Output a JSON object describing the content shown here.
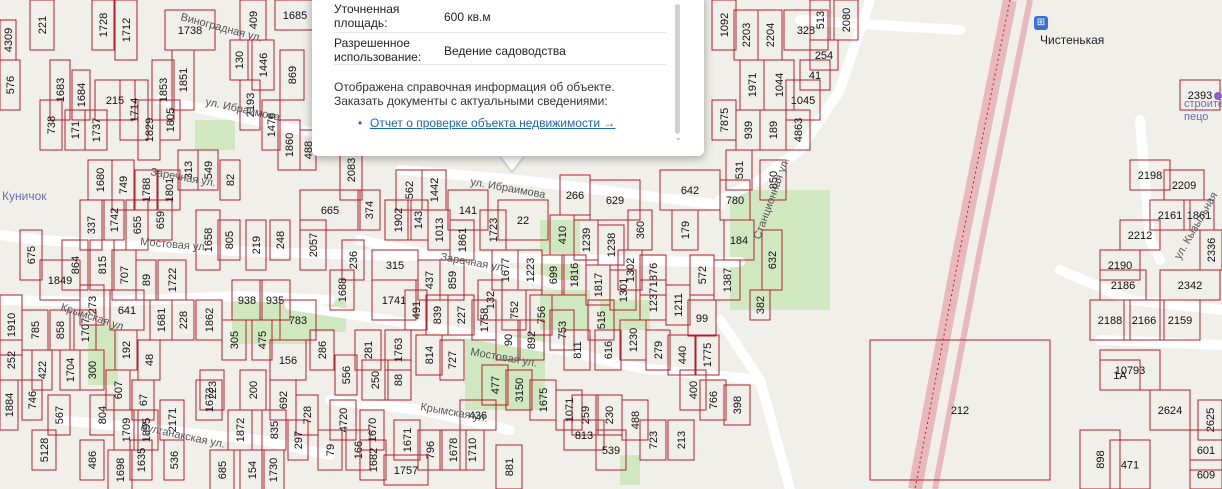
{
  "popup": {
    "rows": [
      {
        "label": "Уточненная площадь:",
        "value": "600 кв.м"
      },
      {
        "label": "Разрешенное использование:",
        "value": "Ведение садоводства"
      }
    ],
    "info_line1": "Отображена справочная информация об объекте.",
    "info_line2": "Заказать документы с актуальными сведениями:",
    "report_link": "Отчет о проверке объекта недвижимости →"
  },
  "station": {
    "icon": "metro-station-icon",
    "label": "Чистенькая"
  },
  "poi": {
    "left": "Куничок",
    "right_top": "строител",
    "right_bottom": "пецо"
  },
  "colors": {
    "parcel_border": "#b3202a",
    "road": "#ffffff",
    "green": "#cfe8c0",
    "background": "#f1efea",
    "link": "#1a66b7"
  },
  "streets": [
    "ул. Ибраимова",
    "Заречная ул.",
    "Мостовая ул.",
    "Крымская ул.",
    "Булганакская ул.",
    "ул. Ибраимова",
    "Заречная ул.",
    "Мостовая ул.",
    "Крымская ул.",
    "Станционная ул.",
    "ул. Кызыльная",
    "Виноградная ул."
  ],
  "parcels": [
    {
      "n": "221"
    },
    {
      "n": "1728"
    },
    {
      "n": "1712"
    },
    {
      "n": "1738"
    },
    {
      "n": "1685"
    },
    {
      "n": "409"
    },
    {
      "n": "576"
    },
    {
      "n": "4309"
    },
    {
      "n": "1683"
    },
    {
      "n": "1684"
    },
    {
      "n": "215"
    },
    {
      "n": "1714"
    },
    {
      "n": "1851"
    },
    {
      "n": "1853"
    },
    {
      "n": "130"
    },
    {
      "n": "1446"
    },
    {
      "n": "869"
    },
    {
      "n": "738"
    },
    {
      "n": "171"
    },
    {
      "n": "1737"
    },
    {
      "n": "1829"
    },
    {
      "n": "1805"
    },
    {
      "n": "2193"
    },
    {
      "n": "1476"
    },
    {
      "n": "1860"
    },
    {
      "n": "488"
    },
    {
      "n": "1680"
    },
    {
      "n": "749"
    },
    {
      "n": "1788"
    },
    {
      "n": "1801"
    },
    {
      "n": "313"
    },
    {
      "n": "549"
    },
    {
      "n": "82"
    },
    {
      "n": "2083"
    },
    {
      "n": "665"
    },
    {
      "n": "374"
    },
    {
      "n": "337"
    },
    {
      "n": "1742"
    },
    {
      "n": "655"
    },
    {
      "n": "659"
    },
    {
      "n": "1658"
    },
    {
      "n": "805"
    },
    {
      "n": "219"
    },
    {
      "n": "248"
    },
    {
      "n": "2057"
    },
    {
      "n": "675"
    },
    {
      "n": "864"
    },
    {
      "n": "815"
    },
    {
      "n": "707"
    },
    {
      "n": "89"
    },
    {
      "n": "1722"
    },
    {
      "n": "938"
    },
    {
      "n": "935"
    },
    {
      "n": "783"
    },
    {
      "n": "1849"
    },
    {
      "n": "273"
    },
    {
      "n": "641"
    },
    {
      "n": "1681"
    },
    {
      "n": "228"
    },
    {
      "n": "1862"
    },
    {
      "n": "305"
    },
    {
      "n": "475"
    },
    {
      "n": "156"
    },
    {
      "n": "286"
    },
    {
      "n": "1910"
    },
    {
      "n": "785"
    },
    {
      "n": "858"
    },
    {
      "n": "1707"
    },
    {
      "n": "192"
    },
    {
      "n": "48"
    },
    {
      "n": "223"
    },
    {
      "n": "200"
    },
    {
      "n": "281"
    },
    {
      "n": "556"
    },
    {
      "n": "252"
    },
    {
      "n": "422"
    },
    {
      "n": "1704"
    },
    {
      "n": "300"
    },
    {
      "n": "607"
    },
    {
      "n": "67"
    },
    {
      "n": "1672"
    },
    {
      "n": "692"
    },
    {
      "n": "728"
    },
    {
      "n": "250"
    },
    {
      "n": "1884"
    },
    {
      "n": "746"
    },
    {
      "n": "567"
    },
    {
      "n": "804"
    },
    {
      "n": "1709"
    },
    {
      "n": "1895"
    },
    {
      "n": "2171"
    },
    {
      "n": "1872"
    },
    {
      "n": "835"
    },
    {
      "n": "297"
    },
    {
      "n": "5128"
    },
    {
      "n": "486"
    },
    {
      "n": "1698"
    },
    {
      "n": "1635"
    },
    {
      "n": "536"
    },
    {
      "n": "685"
    },
    {
      "n": "154"
    },
    {
      "n": "1730"
    },
    {
      "n": "79"
    },
    {
      "n": "166"
    },
    {
      "n": "562"
    },
    {
      "n": "1442"
    },
    {
      "n": "141"
    },
    {
      "n": "22"
    },
    {
      "n": "266"
    },
    {
      "n": "629"
    },
    {
      "n": "642"
    },
    {
      "n": "780"
    },
    {
      "n": "1902"
    },
    {
      "n": "143"
    },
    {
      "n": "1013"
    },
    {
      "n": "1861"
    },
    {
      "n": "1723"
    },
    {
      "n": "410"
    },
    {
      "n": "1239"
    },
    {
      "n": "1238"
    },
    {
      "n": "360"
    },
    {
      "n": "179"
    },
    {
      "n": "184"
    },
    {
      "n": "236"
    },
    {
      "n": "315"
    },
    {
      "n": "437"
    },
    {
      "n": "859"
    },
    {
      "n": "1677"
    },
    {
      "n": "1223"
    },
    {
      "n": "699"
    },
    {
      "n": "1816"
    },
    {
      "n": "1817"
    },
    {
      "n": "1302"
    },
    {
      "n": "1876"
    },
    {
      "n": "572"
    },
    {
      "n": "1387"
    },
    {
      "n": "1688"
    },
    {
      "n": "1741"
    },
    {
      "n": "491"
    },
    {
      "n": "839"
    },
    {
      "n": "227"
    },
    {
      "n": "132"
    },
    {
      "n": "752"
    },
    {
      "n": "756"
    },
    {
      "n": "753"
    },
    {
      "n": "515"
    },
    {
      "n": "1301"
    },
    {
      "n": "1237"
    },
    {
      "n": "1211"
    },
    {
      "n": "99"
    },
    {
      "n": "1763"
    },
    {
      "n": "814"
    },
    {
      "n": "727"
    },
    {
      "n": "1758"
    },
    {
      "n": "90"
    },
    {
      "n": "892"
    },
    {
      "n": "811"
    },
    {
      "n": "616"
    },
    {
      "n": "1230"
    },
    {
      "n": "279"
    },
    {
      "n": "440"
    },
    {
      "n": "1775"
    },
    {
      "n": "88"
    },
    {
      "n": "477"
    },
    {
      "n": "3150"
    },
    {
      "n": "1675"
    },
    {
      "n": "1071"
    },
    {
      "n": "259"
    },
    {
      "n": "230"
    },
    {
      "n": "488"
    },
    {
      "n": "400"
    },
    {
      "n": "766"
    },
    {
      "n": "398"
    },
    {
      "n": "4720"
    },
    {
      "n": "1670"
    },
    {
      "n": "436"
    },
    {
      "n": "813"
    },
    {
      "n": "539"
    },
    {
      "n": "723"
    },
    {
      "n": "213"
    },
    {
      "n": "1682"
    },
    {
      "n": "1671"
    },
    {
      "n": "796"
    },
    {
      "n": "1678"
    },
    {
      "n": "1710"
    },
    {
      "n": "1757"
    },
    {
      "n": "881"
    },
    {
      "n": "632"
    },
    {
      "n": "382"
    },
    {
      "n": "212"
    },
    {
      "n": "1092"
    },
    {
      "n": "2203"
    },
    {
      "n": "2204"
    },
    {
      "n": "328"
    },
    {
      "n": "513"
    },
    {
      "n": "2080"
    },
    {
      "n": "254"
    },
    {
      "n": "41"
    },
    {
      "n": "1971"
    },
    {
      "n": "1044"
    },
    {
      "n": "1045"
    },
    {
      "n": "7875"
    },
    {
      "n": "939"
    },
    {
      "n": "189"
    },
    {
      "n": "4863"
    },
    {
      "n": "531"
    },
    {
      "n": "850"
    },
    {
      "n": "2198"
    },
    {
      "n": "2209"
    },
    {
      "n": "2161"
    },
    {
      "n": "1861"
    },
    {
      "n": "2212"
    },
    {
      "n": "2190"
    },
    {
      "n": "2186"
    },
    {
      "n": "2342"
    },
    {
      "n": "2188"
    },
    {
      "n": "2166"
    },
    {
      "n": "2159"
    },
    {
      "n": "10793"
    },
    {
      "n": "2624"
    },
    {
      "n": "2625"
    },
    {
      "n": "601"
    },
    {
      "n": "898"
    },
    {
      "n": "471"
    },
    {
      "n": "609"
    },
    {
      "n": "2393"
    },
    {
      "n": "2336"
    },
    {
      "n": "1A"
    }
  ]
}
